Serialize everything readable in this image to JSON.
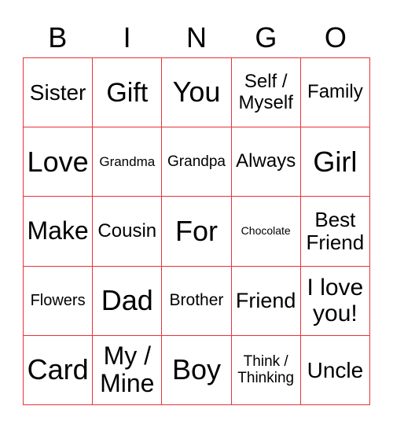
{
  "header": [
    "B",
    "I",
    "N",
    "G",
    "O"
  ],
  "grid_color": "#e8323a",
  "cells": [
    [
      "Sister",
      "Gift",
      "You",
      "Self / Myself",
      "Family"
    ],
    [
      "Love",
      "Grandma",
      "Grandpa",
      "Always",
      "Girl"
    ],
    [
      "Make",
      "Cousin",
      "For",
      "Chocolate",
      "Best Friend"
    ],
    [
      "Flowers",
      "Dad",
      "Brother",
      "Friend",
      "I love you!"
    ],
    [
      "Card",
      "My / Mine",
      "Boy",
      "Think / Thinking",
      "Uncle"
    ]
  ]
}
